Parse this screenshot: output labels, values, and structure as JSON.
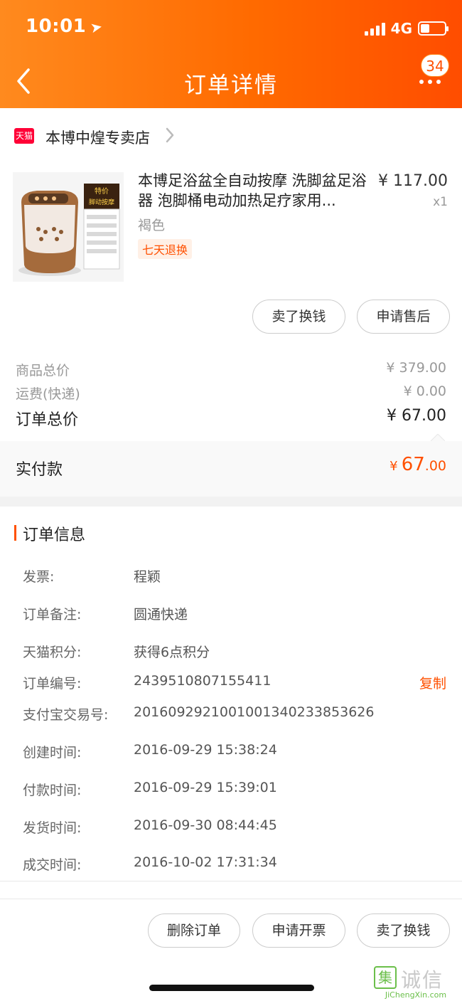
{
  "status_bar": {
    "time": "10:01",
    "network": "4G"
  },
  "header": {
    "title": "订单详情",
    "badge_count": "34"
  },
  "shop": {
    "logo_text": "天猫",
    "name": "本博中煌专卖店"
  },
  "product": {
    "name": "本博足浴盆全自动按摩 洗脚盆足浴器 泡脚桶电动加热足疗家用...",
    "spec": "褐色",
    "tag": "七天退换",
    "price": "¥ 117.00",
    "qty": "x1",
    "image_labels": [
      "特价",
      "脚动按摩"
    ]
  },
  "item_actions": {
    "sell_label": "卖了换钱",
    "after_sale_label": "申请售后"
  },
  "totals": {
    "goods_label": "商品总价",
    "goods_value": "¥ 379.00",
    "shipping_label": "运费(快递)",
    "shipping_value": "¥ 0.00",
    "order_total_label": "订单总价",
    "order_total_value": "¥ 67.00",
    "paid_label": "实付款",
    "paid_currency": "¥",
    "paid_int": "67",
    "paid_dec": ".00"
  },
  "order_info": {
    "title": "订单信息",
    "copy_label": "复制",
    "rows": [
      {
        "key": "发票:",
        "value": "程颖"
      },
      {
        "key": "订单备注:",
        "value": "圆通快递"
      },
      {
        "key": "天猫积分:",
        "value": "获得6点积分"
      },
      {
        "key": "订单编号:",
        "value": "2439510807155411"
      },
      {
        "key": "支付宝交易号:",
        "value": "2016092921001001340233853626"
      },
      {
        "key": "创建时间:",
        "value": "2016-09-29 15:38:24"
      },
      {
        "key": "付款时间:",
        "value": "2016-09-29 15:39:01"
      },
      {
        "key": "发货时间:",
        "value": "2016-09-30 08:44:45"
      },
      {
        "key": "成交时间:",
        "value": "2016-10-02 17:31:34"
      }
    ]
  },
  "bottom_actions": {
    "delete_label": "删除订单",
    "invoice_label": "申请开票",
    "sell_label": "卖了换钱"
  },
  "watermark": {
    "logo_char": "集",
    "text": "诚信",
    "url": "JiChengXin.com"
  },
  "colors": {
    "accent": "#ff5000",
    "header_start": "#ff8a1e",
    "header_end": "#ff4d00"
  }
}
